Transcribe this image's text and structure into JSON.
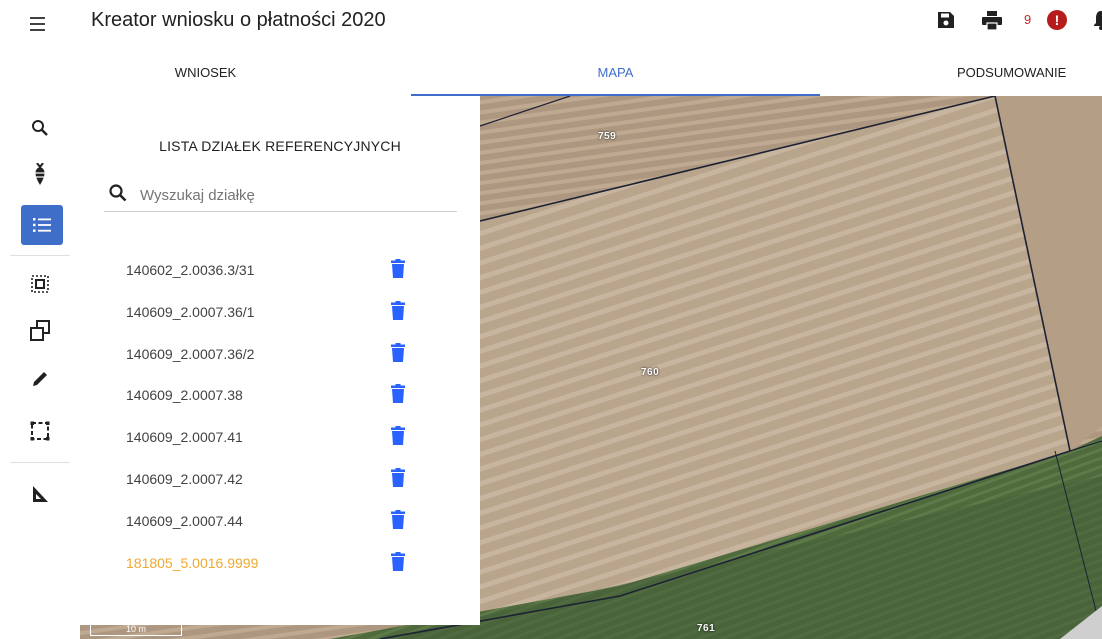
{
  "header": {
    "title": "Kreator wniosku o płatności 2020",
    "error_count": "9",
    "error_icon_glyph": "!",
    "icons": [
      "menu-icon",
      "save-icon",
      "print-icon",
      "error-icon",
      "bell-icon"
    ]
  },
  "tabs": [
    {
      "label": "WNIOSEK",
      "active": false
    },
    {
      "label": "MAPA",
      "active": true
    },
    {
      "label": "PODSUMOWANIE",
      "active": false
    }
  ],
  "toolbar": {
    "tools": [
      "search-icon",
      "plant-icon",
      "list-icon",
      "select-area-icon",
      "copy-polygon-icon",
      "pencil-icon",
      "rectangle-select-icon",
      "measure-icon"
    ],
    "active_tool": "list-icon"
  },
  "panel": {
    "title": "LISTA DZIAŁEK REFERENCYJNYCH",
    "search_placeholder": "Wyszukaj działkę",
    "search_value": "",
    "parcels": [
      {
        "name": "140602_2.0036.3/31",
        "highlighted": false
      },
      {
        "name": "140609_2.0007.36/1",
        "highlighted": false
      },
      {
        "name": "140609_2.0007.36/2",
        "highlighted": false
      },
      {
        "name": "140609_2.0007.38",
        "highlighted": false
      },
      {
        "name": "140609_2.0007.41",
        "highlighted": false
      },
      {
        "name": "140609_2.0007.42",
        "highlighted": false
      },
      {
        "name": "140609_2.0007.44",
        "highlighted": false
      },
      {
        "name": "181805_5.0016.9999",
        "highlighted": true
      }
    ]
  },
  "map": {
    "parcel_labels": [
      "759",
      "760",
      "761"
    ],
    "scale_label": "10 m"
  },
  "colors": {
    "accent": "#3f6ec9",
    "trash": "#2962ff",
    "highlight": "#f0a830",
    "error": "#b71c1c"
  }
}
